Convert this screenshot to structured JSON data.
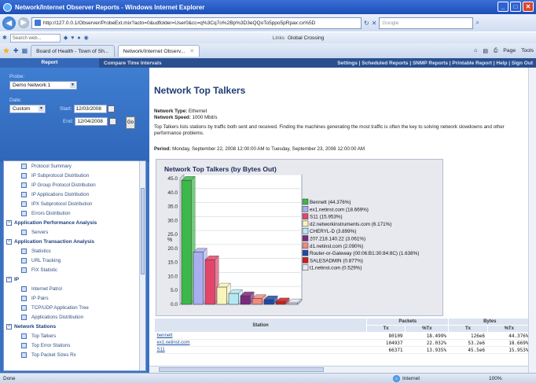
{
  "window": {
    "title": "Network/Internet Observer Reports - Windows Internet Explorer",
    "controls": [
      "_",
      "□",
      "✕"
    ]
  },
  "browser": {
    "address": "http://127.0.0.1/Observer/ProbeExt.mix?actn=0&udfolder=User0&cc=q%3Cq7o%2Bp%3D3eQQoTo5ppo5pRpax:cx%5D",
    "search_placeholder": "Google",
    "toolbar_search_placeholder": "Search web...",
    "links_label": "Links",
    "links_item": "Global Crossing",
    "tabs": [
      {
        "label": "Board of Health - Town of Sh...",
        "active": false
      },
      {
        "label": "Network/Internet Observ...",
        "active": true
      }
    ],
    "tool_labels": [
      "Page",
      "Tools"
    ]
  },
  "appnav": {
    "report_tab": "Report",
    "compare_tab": "Compare Time Intervals",
    "right_links": "Settings | Scheduled Reports | SNMP Reports | Printable Report | Help | Sign Out"
  },
  "left": {
    "probe_label": "Probe:",
    "probe_value": "Demo Network 1",
    "date_label": "Date:",
    "date_mode": "Custom",
    "start_label": "Start:",
    "start_value": "12/03/2008",
    "end_label": "End:",
    "end_value": "12/04/2008",
    "go_label": "Go",
    "tree": [
      {
        "type": "item",
        "label": "Protocol Summary"
      },
      {
        "type": "item",
        "label": "IP Subprotocol Distribution"
      },
      {
        "type": "item",
        "label": "IP Group Protocol Distribution"
      },
      {
        "type": "item",
        "label": "IP Applications Distribution"
      },
      {
        "type": "item",
        "label": "IPX Subprotocol Distribution"
      },
      {
        "type": "item",
        "label": "Errors Distribution"
      },
      {
        "type": "group",
        "label": "Application Performance Analysis"
      },
      {
        "type": "item",
        "label": "Servers"
      },
      {
        "type": "group",
        "label": "Application Transaction Analysis"
      },
      {
        "type": "item",
        "label": "Statistics"
      },
      {
        "type": "item",
        "label": "URL Tracking"
      },
      {
        "type": "item",
        "label": "FIX Statistic"
      },
      {
        "type": "group",
        "label": "IP"
      },
      {
        "type": "item",
        "label": "Internet Patrol"
      },
      {
        "type": "item",
        "label": "IP Pairs"
      },
      {
        "type": "item",
        "label": "TCP/UDP Application Tree"
      },
      {
        "type": "item",
        "label": "Applications Distribution"
      },
      {
        "type": "group",
        "label": "Network Stations"
      },
      {
        "type": "item",
        "label": "Top Talkers"
      },
      {
        "type": "item",
        "label": "Top Error Stations"
      },
      {
        "type": "item",
        "label": "Top Packet Sizes Rx"
      }
    ]
  },
  "main": {
    "title": "Network Top Talkers",
    "network_type_label": "Network Type:",
    "network_type": "Ethernet",
    "network_speed_label": "Network Speed:",
    "network_speed": "1000 Mbit/s",
    "description": "Top Talkers lists stations by traffic both sent and received. Finding the machines generating the most traffic is often the key to solving network slowdowns and other performance problems.",
    "period_label": "Period:",
    "period": "Monday, September 22, 2008 12:00:00 AM to Tuesday, September 23, 2008 12:00:00 AM"
  },
  "chart_data": {
    "type": "bar",
    "title": "Network Top Talkers (by Bytes Out)",
    "ylabel": "%",
    "ylim": [
      0,
      45
    ],
    "yticks": [
      "45.0",
      "40.0",
      "35.0",
      "30.0",
      "25.0",
      "20.0",
      "15.0",
      "10.0",
      "5.0",
      "0.0"
    ],
    "categories": [
      "Bennett (44.376%)",
      "ex1.netinst.com (18.669%)",
      "S11 (15.953%)",
      "d2.networkinstruments.com (6.171%)",
      "CHERYL-D (3.899%)",
      "207.218.140.22 (3.061%)",
      "d1.netinst.com (2.090%)",
      "Router-or-Gateway (00:06:B1:30:84:8C) (1.638%)",
      "SALESADMIN (0.877%)",
      "t1.netinst.com (0.529%)"
    ],
    "values": [
      44.376,
      18.669,
      15.953,
      6.171,
      3.899,
      3.061,
      2.09,
      1.638,
      0.877,
      0.529
    ],
    "colors": [
      "#3cb84a",
      "#a9aef0",
      "#e2476a",
      "#f7f5bc",
      "#b6e8f4",
      "#7a2a7c",
      "#f08a7e",
      "#1e49a8",
      "#cc1e1e",
      "#e6e8f2"
    ],
    "legend_position": "right"
  },
  "table": {
    "header_station": "Station",
    "header_packets": "Packets",
    "header_bytes": "Bytes",
    "sub_headers": [
      "Tx",
      "%Tx",
      "Tx",
      "%Tx"
    ],
    "rows": [
      {
        "station": "bennett",
        "tx": "80109",
        "ptx": "18.499%",
        "btx": "126e6",
        "pbtx": "44.376%"
      },
      {
        "station": "ex1.netinst.com",
        "tx": "104937",
        "ptx": "22.032%",
        "btx": "53.2e6",
        "pbtx": "18.669%"
      },
      {
        "station": "S11",
        "tx": "66371",
        "ptx": "13.935%",
        "btx": "45.5e6",
        "pbtx": "15.953%"
      }
    ]
  },
  "status": {
    "left": "Done",
    "zone": "Internet",
    "zoom": "100%"
  }
}
